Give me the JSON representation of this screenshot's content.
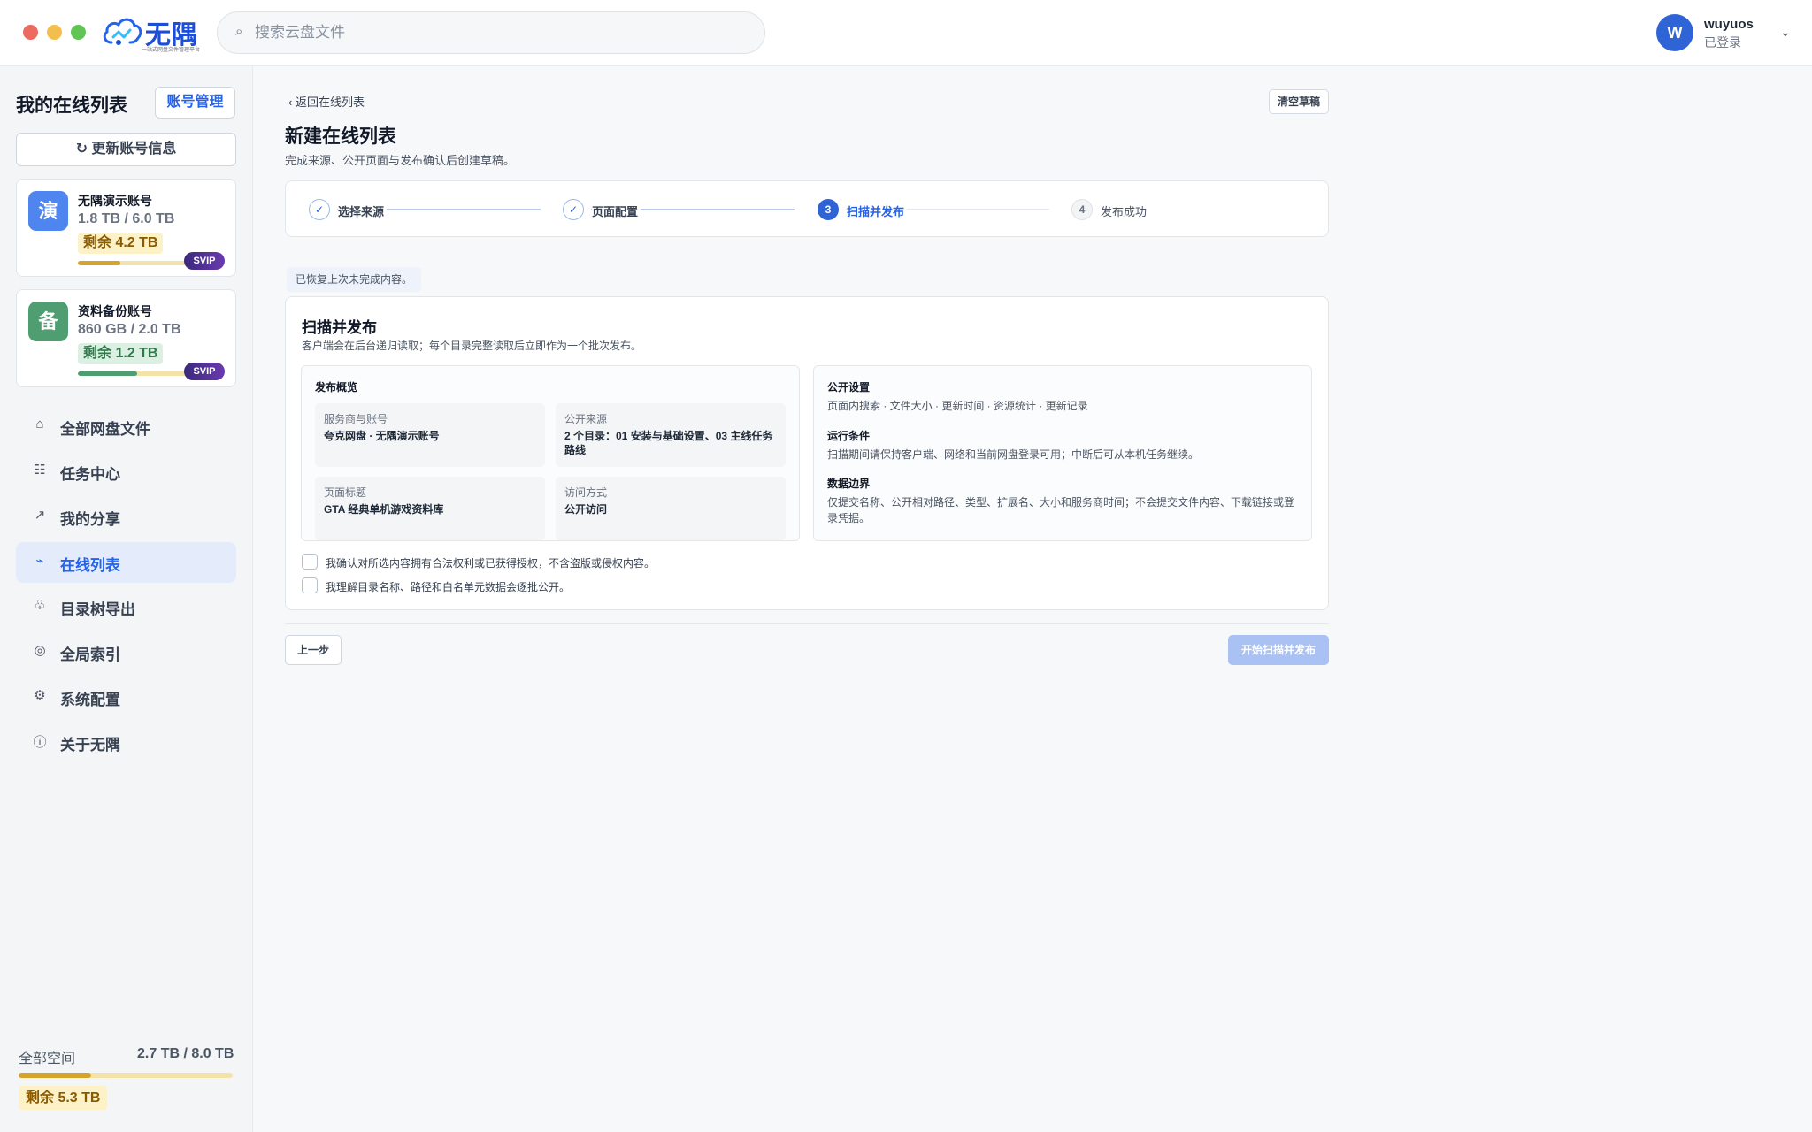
{
  "app": {
    "name": "无隅",
    "tagline": "一站式网盘文件管理平台"
  },
  "search": {
    "placeholder": "搜索云盘文件"
  },
  "user": {
    "initial": "W",
    "name": "wuyuos",
    "status": "已登录"
  },
  "sidebar": {
    "title": "我的在线列表",
    "account_manage": "账号管理",
    "refresh": "更新账号信息",
    "accounts": [
      {
        "icon_char": "演",
        "name": "无隅演示账号",
        "usage": "1.8 TB / 6.0 TB",
        "remaining": "剩余 4.2 TB",
        "badge": "SVIP",
        "used_fraction": 0.3
      },
      {
        "icon_char": "备",
        "name": "资料备份账号",
        "usage": "860 GB / 2.0 TB",
        "remaining": "剩余 1.2 TB",
        "badge": "SVIP",
        "used_fraction": 0.42
      }
    ],
    "nav": [
      {
        "icon": "home-icon",
        "label": "全部网盘文件"
      },
      {
        "icon": "tasks-icon",
        "label": "任务中心"
      },
      {
        "icon": "share-icon",
        "label": "我的分享"
      },
      {
        "icon": "online-list-icon",
        "label": "在线列表",
        "active": true
      },
      {
        "icon": "tree-icon",
        "label": "目录树导出"
      },
      {
        "icon": "index-icon",
        "label": "全局索引"
      },
      {
        "icon": "gear-icon",
        "label": "系统配置"
      },
      {
        "icon": "info-icon",
        "label": "关于无隅"
      }
    ],
    "total": {
      "label": "全部空间",
      "value": "2.7 TB / 8.0 TB",
      "remaining": "剩余 5.3 TB",
      "used_fraction": 0.34
    }
  },
  "main": {
    "back": "返回在线列表",
    "clear_draft": "清空草稿",
    "title": "新建在线列表",
    "subtitle": "完成来源、公开页面与发布确认后创建草稿。",
    "steps": [
      {
        "num": "1",
        "label": "选择来源",
        "state": "done"
      },
      {
        "num": "2",
        "label": "页面配置",
        "state": "done"
      },
      {
        "num": "3",
        "label": "扫描并发布",
        "state": "current"
      },
      {
        "num": "4",
        "label": "发布成功",
        "state": "todo"
      }
    ],
    "restore_note": "已恢复上次未完成内容。",
    "panel": {
      "title": "扫描并发布",
      "subtitle": "客户端会在后台递归读取；每个目录完整读取后立即作为一个批次发布。",
      "overview": {
        "title": "发布概览",
        "cells": [
          {
            "key": "服务商与账号",
            "value": "夸克网盘 · 无隅演示账号"
          },
          {
            "key": "公开来源",
            "value": "2 个目录：01 安装与基础设置、03 主线任务路线"
          },
          {
            "key": "页面标题",
            "value": "GTA 经典单机游戏资料库"
          },
          {
            "key": "访问方式",
            "value": "公开访问"
          }
        ]
      },
      "settings": [
        {
          "title": "公开设置",
          "text": "页面内搜索 · 文件大小 · 更新时间 · 资源统计 · 更新记录"
        },
        {
          "title": "运行条件",
          "text": "扫描期间请保持客户端、网络和当前网盘登录可用；中断后可从本机任务继续。"
        },
        {
          "title": "数据边界",
          "text": "仅提交名称、公开相对路径、类型、扩展名、大小和服务商时间；不会提交文件内容、下载链接或登录凭据。"
        }
      ],
      "confirms": [
        {
          "text": "我确认对所选内容拥有合法权利或已获得授权，不含盗版或侵权内容。",
          "checked": false
        },
        {
          "text": "我理解目录名称、路径和白名单元数据会逐批公开。",
          "checked": false
        }
      ]
    },
    "prev": "上一步",
    "publish": "开始扫描并发布"
  },
  "colors": {
    "accent": "#2f64d6",
    "active_nav_bg": "#e4ecfb",
    "gold": "#d7a42a",
    "green": "#4f9e72"
  }
}
